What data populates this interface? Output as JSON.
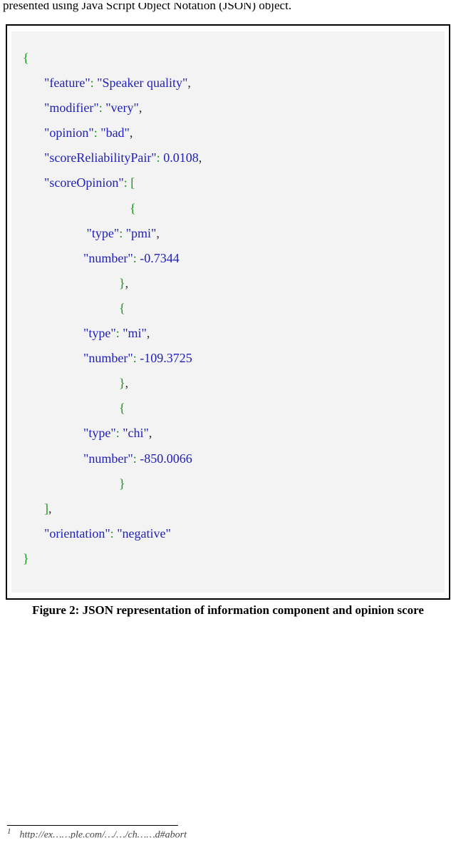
{
  "headerFragmentText": "presented using Java Script Object Notation (JSON)  object.",
  "json": {
    "openBrace": "{",
    "closeBrace": "}",
    "openBracket": "[",
    "closeBracket": "]",
    "colon": ":",
    "comma": ",",
    "keys": {
      "feature": "\"feature\"",
      "modifier": "\"modifier\"",
      "opinion": "\"opinion\"",
      "scoreReliabilityPair": "\"scoreReliabilityPair\"",
      "scoreOpinion": "\"scoreOpinion\"",
      "type": "\"type\"",
      "number": "\"number\"",
      "orientation": "\"orientation\""
    },
    "vals": {
      "feature": "\"Speaker quality\"",
      "modifier": "\"very\"",
      "opinion": "\"bad\"",
      "scoreReliabilityPair": "0.0108",
      "type_pmi": "\"pmi\"",
      "num_pmi": "-0.7344",
      "type_mi": "\"mi\"",
      "num_mi": "-109.3725",
      "type_chi": "\"chi\"",
      "num_chi": "-850.0066",
      "orientation": "\"negative\""
    }
  },
  "captionText": "Figure 2: JSON representation of information component and opinion score",
  "footnoteMarker": "1",
  "footnoteFragmentText": "http://ex……ple.com/…/…/ch……d#abort"
}
